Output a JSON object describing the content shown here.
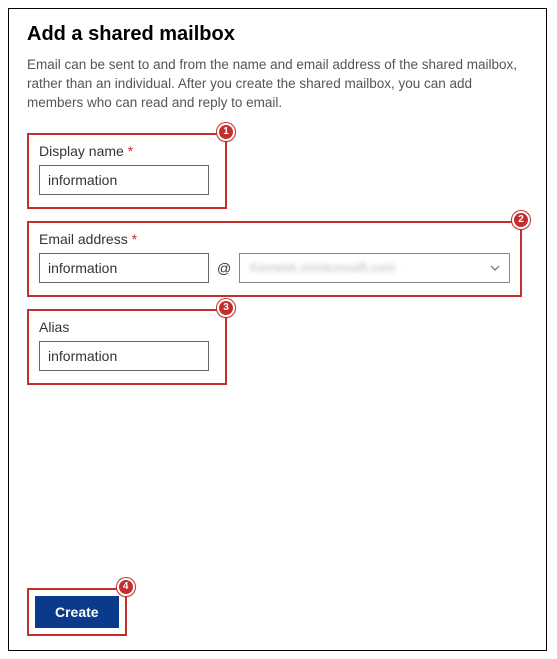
{
  "title": "Add a shared mailbox",
  "description": "Email can be sent to and from the name and email address of the shared mailbox, rather than an individual. After you create the shared mailbox, you can add members who can read and reply to email.",
  "fields": {
    "displayName": {
      "label": "Display name",
      "required": "*",
      "value": "information"
    },
    "emailAddress": {
      "label": "Email address",
      "required": "*",
      "localValue": "information",
      "at": "@",
      "domain": "KernelA.onmicrosoft.com"
    },
    "alias": {
      "label": "Alias",
      "value": "information"
    }
  },
  "annotations": {
    "b1": "1",
    "b2": "2",
    "b3": "3",
    "b4": "4"
  },
  "buttons": {
    "create": "Create"
  }
}
